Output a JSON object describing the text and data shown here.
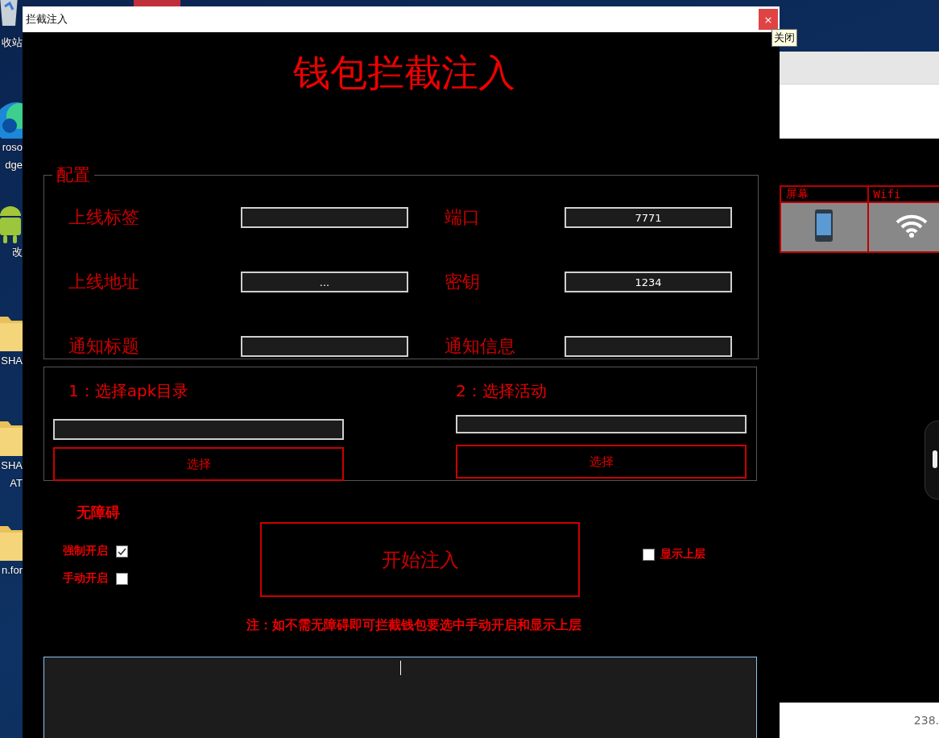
{
  "desktop_icons": [
    {
      "kind": "recycle",
      "lines": [
        "收站"
      ]
    },
    {
      "kind": "edge",
      "lines": [
        "roso",
        "dge"
      ]
    },
    {
      "kind": "android",
      "lines": [
        "改"
      ]
    },
    {
      "kind": "folder",
      "lines": [
        "SHA"
      ]
    },
    {
      "kind": "folder",
      "lines": [
        "SHA",
        "AT"
      ]
    },
    {
      "kind": "folder",
      "lines": [
        "n.for"
      ]
    }
  ],
  "window": {
    "title": "拦截注入",
    "close_button": "×",
    "close_tooltip": "关闭"
  },
  "heading": "钱包拦截注入",
  "config": {
    "legend": "配置",
    "fields": [
      {
        "label": "上线标签"
      },
      {
        "label": "端口",
        "value": "7771"
      },
      {
        "label": "上线地址",
        "value": "..."
      },
      {
        "label": "密钥",
        "value": "1234"
      },
      {
        "label": "通知标题"
      },
      {
        "label": "通知信息"
      }
    ]
  },
  "apk": {
    "columns": [
      {
        "label": "1：选择apk目录",
        "button": "选择"
      },
      {
        "label": "2：选择活动",
        "button": "选择"
      }
    ]
  },
  "accessibility": {
    "title": "无障碍",
    "options": [
      {
        "label": "强制开启",
        "checked": true
      },
      {
        "label": "手动开启",
        "checked": false
      }
    ]
  },
  "start_button": "开始注入",
  "show_top": {
    "label": "显示上层",
    "checked": false
  },
  "note": "注：如不需无障碍即可拦截钱包要选中手动开启和显示上层",
  "background_window": {
    "table": {
      "columns": [
        {
          "label": "屏幕",
          "kind": "phone"
        },
        {
          "label": "Wifi",
          "kind": "wifi"
        }
      ]
    },
    "status_text": "238."
  }
}
